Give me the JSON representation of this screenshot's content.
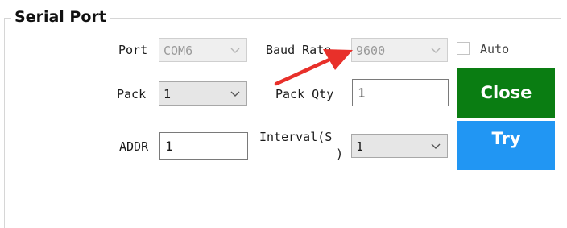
{
  "group": {
    "title": "Serial Port"
  },
  "port": {
    "label": "Port",
    "value": "COM6"
  },
  "baud_rate": {
    "label": "Baud Rate",
    "value": "9600"
  },
  "auto": {
    "label": "Auto",
    "checked": false
  },
  "pack": {
    "label": "Pack",
    "value": "1"
  },
  "pack_qty": {
    "label": "Pack Qty",
    "value": "1"
  },
  "addr": {
    "label": "ADDR",
    "value": "1"
  },
  "interval": {
    "label_line1": "Interval(S",
    "label_line2": ")",
    "value": "1"
  },
  "buttons": {
    "close_label": "Close",
    "try_label": "Try"
  },
  "colors": {
    "close_bg": "#0a7d12",
    "try_bg": "#2196f3",
    "annotation_arrow": "#e8302a"
  },
  "icons": {
    "dropdown": "chevron-down-icon",
    "annotation": "red-arrow"
  }
}
